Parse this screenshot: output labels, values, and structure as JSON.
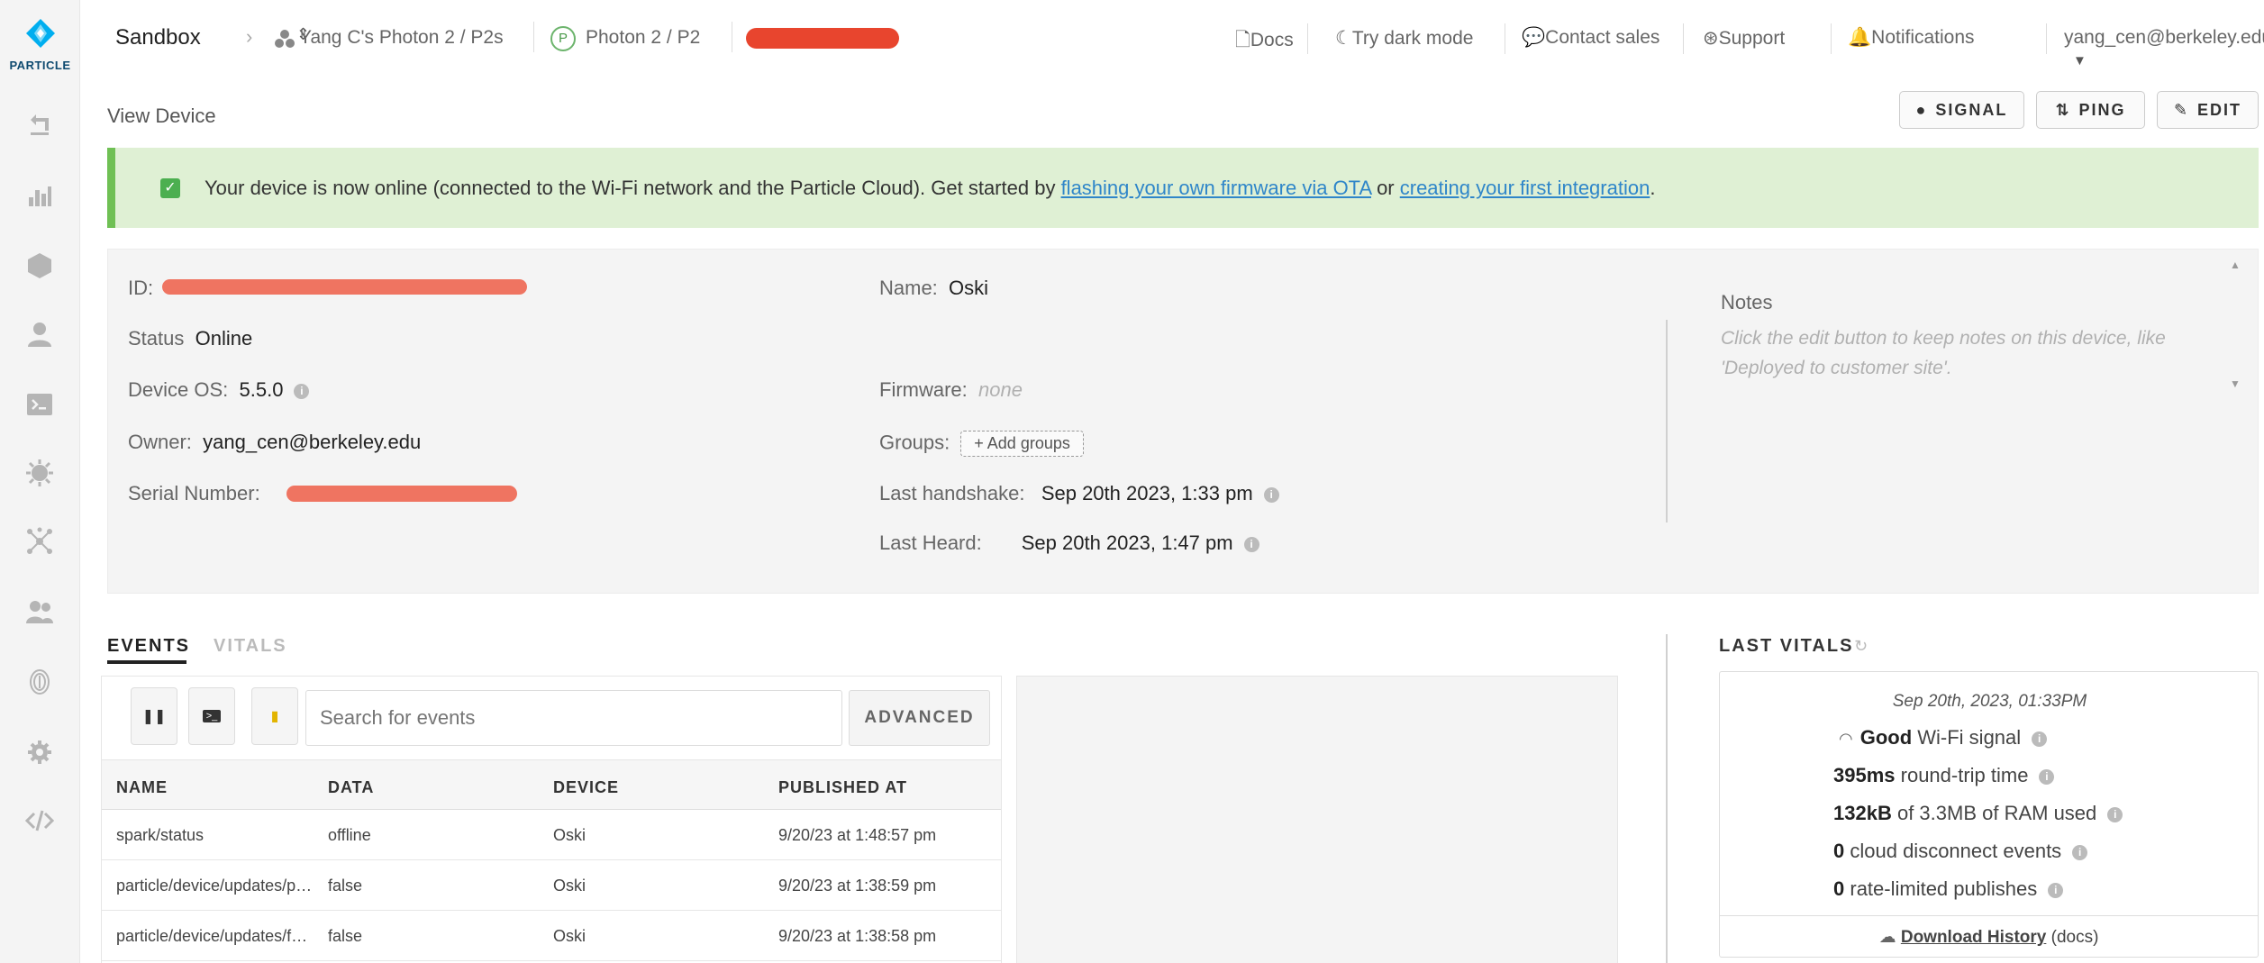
{
  "brand": {
    "logo_text": "PARTICLE",
    "accent": "#00aeef",
    "success": "#6fc054"
  },
  "topnav": {
    "org": "Sandbox",
    "product": "Yang C's Photon 2 / P2s",
    "platform_badge": "P",
    "platform": "Photon 2 / P2",
    "links": {
      "docs": "Docs",
      "dark_mode": "Try dark mode",
      "contact": "Contact sales",
      "support": "Support",
      "notifications": "Notifications",
      "user": "yang_cen@berkeley.edu"
    }
  },
  "header": {
    "title": "View Device",
    "signal": "SIGNAL",
    "ping": "PING",
    "edit": "EDIT"
  },
  "banner": {
    "text_before": "Your device is now online (connected to the Wi-Fi network and the Particle Cloud). Get started by ",
    "link1": "flashing your own firmware via OTA",
    "text_mid": " or ",
    "link2": "creating your first integration",
    "text_after": "."
  },
  "device": {
    "id_label": "ID:",
    "status_label": "Status",
    "status": "Online",
    "os_label": "Device OS:",
    "os": "5.5.0",
    "owner_label": "Owner:",
    "owner": "yang_cen@berkeley.edu",
    "serial_label": "Serial Number:",
    "name_label": "Name:",
    "name": "Oski",
    "firmware_label": "Firmware:",
    "firmware": "none",
    "groups_label": "Groups:",
    "add_groups": "+ Add groups",
    "handshake_label": "Last handshake:",
    "handshake": "Sep 20th 2023, 1:33 pm",
    "heard_label": "Last Heard:",
    "heard": "Sep 20th 2023, 1:47 pm",
    "info_glyph": "i"
  },
  "notes": {
    "title": "Notes",
    "placeholder": "Click the edit button to keep notes on this device, like 'Deployed to customer site'."
  },
  "tabs": {
    "events": "EVENTS",
    "vitals": "VITALS"
  },
  "events": {
    "search_placeholder": "Search for events",
    "advanced": "ADVANCED",
    "columns": [
      "NAME",
      "DATA",
      "DEVICE",
      "PUBLISHED AT"
    ],
    "rows": [
      {
        "name": "spark/status",
        "data": "offline",
        "device": "Oski",
        "published": "9/20/23 at 1:48:57 pm"
      },
      {
        "name": "particle/device/updates/pending",
        "data": "false",
        "device": "Oski",
        "published": "9/20/23 at 1:38:59 pm"
      },
      {
        "name": "particle/device/updates/forced",
        "data": "false",
        "device": "Oski",
        "published": "9/20/23 at 1:38:58 pm"
      }
    ]
  },
  "vitals": {
    "title": "LAST VITALS",
    "date": "Sep 20th, 2023, 01:33PM",
    "signal_value": "Good",
    "signal_text": " Wi-Fi signal",
    "rtt_value": "395ms",
    "rtt_text": " round-trip time",
    "ram_value": "132kB",
    "ram_text": " of 3.3MB of RAM used",
    "disconnect_value": "0",
    "disconnect_text": " cloud disconnect events",
    "ratelimit_value": "0",
    "ratelimit_text": " rate-limited publishes",
    "download": "Download History",
    "docs": "(docs)"
  }
}
